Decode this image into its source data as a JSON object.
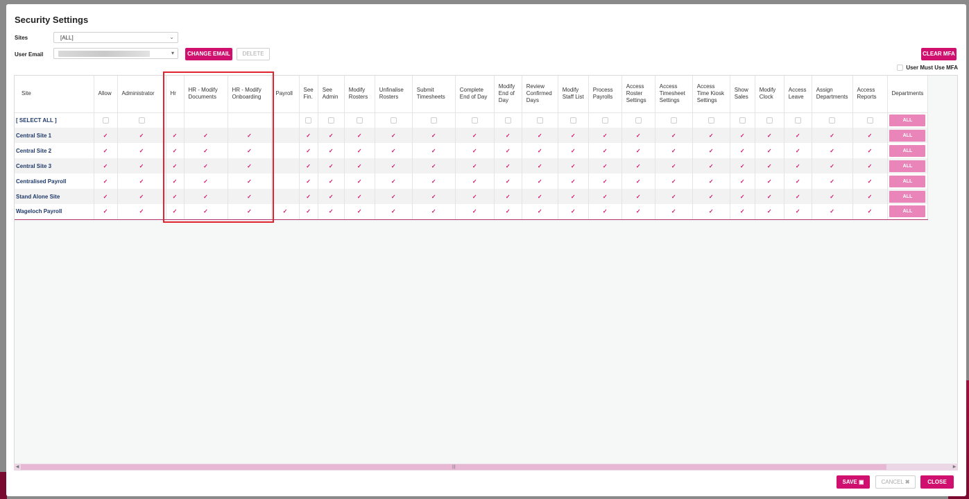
{
  "dialog": {
    "title": "Security Settings"
  },
  "form": {
    "sites_label": "Sites",
    "sites_value": "[ALL]",
    "user_email_label": "User Email",
    "change_email_label": "CHANGE EMAIL",
    "delete_label": "DELETE",
    "clear_mfa_label": "CLEAR MFA",
    "mfa_label": "User Must Use MFA",
    "mfa_checked": false
  },
  "table": {
    "columns": [
      "Site",
      "Allow",
      "Administrator",
      "Hr",
      "HR - Modify Documents",
      "HR - Modify Onboarding",
      "Payroll",
      "See Fin.",
      "See Admin",
      "Modify Rosters",
      "Unfinalise Rosters",
      "Submit Timesheets",
      "Complete End of Day",
      "Modify End of Day",
      "Review Confirmed Days",
      "Modify Staff List",
      "Process Payrolls",
      "Access Roster Settings",
      "Access Timesheet Settings",
      "Access Time Kiosk Settings",
      "Show Sales",
      "Modify Clock",
      "Access Leave",
      "Assign Departments",
      "Access Reports",
      "Departments"
    ],
    "select_all_label": "[ SELECT ALL ]",
    "all_button_label": "ALL",
    "rows": [
      {
        "site": "Central Site 1",
        "flags": [
          true,
          true,
          true,
          true,
          true,
          false,
          true,
          true,
          true,
          true,
          true,
          true,
          true,
          true,
          true,
          true,
          true,
          true,
          true,
          true,
          true,
          true,
          true,
          true
        ]
      },
      {
        "site": "Central Site 2",
        "flags": [
          true,
          true,
          true,
          true,
          true,
          false,
          true,
          true,
          true,
          true,
          true,
          true,
          true,
          true,
          true,
          true,
          true,
          true,
          true,
          true,
          true,
          true,
          true,
          true
        ]
      },
      {
        "site": "Central Site 3",
        "flags": [
          true,
          true,
          true,
          true,
          true,
          false,
          true,
          true,
          true,
          true,
          true,
          true,
          true,
          true,
          true,
          true,
          true,
          true,
          true,
          true,
          true,
          true,
          true,
          true
        ]
      },
      {
        "site": "Centralised Payroll",
        "flags": [
          true,
          true,
          true,
          true,
          true,
          false,
          true,
          true,
          true,
          true,
          true,
          true,
          true,
          true,
          true,
          true,
          true,
          true,
          true,
          true,
          true,
          true,
          true,
          true
        ]
      },
      {
        "site": "Stand Alone Site",
        "flags": [
          true,
          true,
          true,
          true,
          true,
          false,
          true,
          true,
          true,
          true,
          true,
          true,
          true,
          true,
          true,
          true,
          true,
          true,
          true,
          true,
          true,
          true,
          true,
          true
        ]
      },
      {
        "site": "Wageloch Payroll",
        "flags": [
          true,
          true,
          true,
          true,
          true,
          true,
          true,
          true,
          true,
          true,
          true,
          true,
          true,
          true,
          true,
          true,
          true,
          true,
          true,
          true,
          true,
          true,
          true,
          true
        ]
      }
    ]
  },
  "footer": {
    "save_label": "SAVE",
    "cancel_label": "CANCEL",
    "close_label": "CLOSE"
  },
  "colors": {
    "accent": "#d0106e",
    "highlight": "#e0242e"
  }
}
